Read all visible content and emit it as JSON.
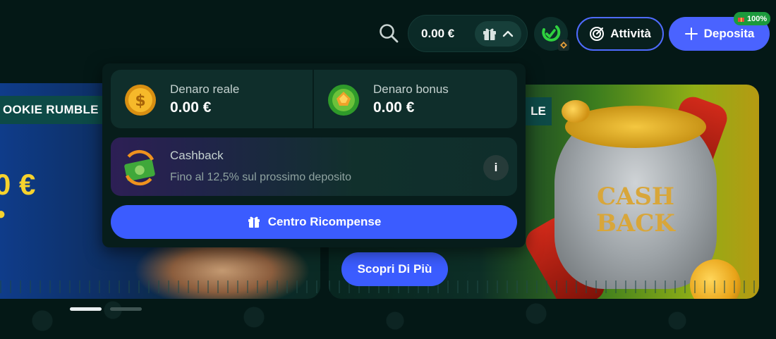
{
  "header": {
    "balance": "0.00 €",
    "activity_label": "Attività",
    "deposit_label": "Deposita",
    "deposit_tag": "100%"
  },
  "banners": {
    "left_tag": "OOKIE RUMBLE",
    "left_amount": "0 €",
    "right_tag": "LE",
    "right_art_text_line1": "CASH",
    "right_art_text_line2": "BACK",
    "discover_label": "Scopri Di Più"
  },
  "wallet": {
    "real_label": "Denaro reale",
    "real_value": "0.00 €",
    "bonus_label": "Denaro bonus",
    "bonus_value": "0.00 €",
    "cashback_title": "Cashback",
    "cashback_subtitle": "Fino al 12,5% sul prossimo deposito",
    "info_label": "i",
    "rewards_label": "Centro Ricompense"
  },
  "carousel": {
    "slides": 2,
    "active": 1
  },
  "colors": {
    "background": "#041816",
    "accent_blue": "#3b5cff",
    "card": "#0f2e2b",
    "level_green": "#27c93f",
    "tag_green": "#1c9a3c"
  },
  "icons": [
    "search-icon",
    "gift-icon",
    "chevron-up-icon",
    "level-icon",
    "target-icon",
    "plus-icon",
    "coin-icon",
    "bonus-chip-icon",
    "cashback-icon"
  ]
}
